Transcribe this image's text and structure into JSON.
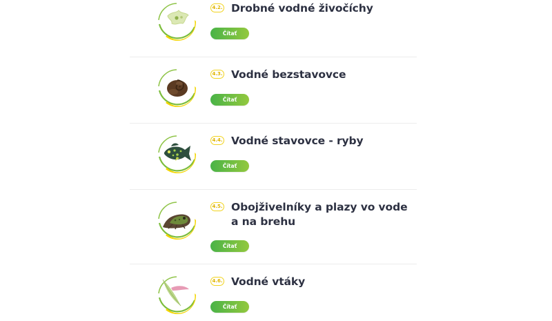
{
  "accent": {
    "green_start": "#49b347",
    "green_end": "#93c83e",
    "yellow": "#f1d31d",
    "title_color": "#2d3142"
  },
  "items": [
    {
      "number": "4.2.",
      "title": "Drobné vodné živočíchy",
      "button": "Čítať",
      "icon": "micro-animal-icon"
    },
    {
      "number": "4.3.",
      "title": "Vodné bezstavovce",
      "button": "Čítať",
      "icon": "snail-icon"
    },
    {
      "number": "4.4.",
      "title": "Vodné stavovce - ryby",
      "button": "Čítať",
      "icon": "fish-icon"
    },
    {
      "number": "4.5.",
      "title": "Obojživelníky a plazy vo vode a na brehu",
      "button": "Čítať",
      "icon": "frog-icon"
    },
    {
      "number": "4.6.",
      "title": "Vodné vtáky",
      "button": "Čítať",
      "icon": "feather-icon"
    }
  ]
}
